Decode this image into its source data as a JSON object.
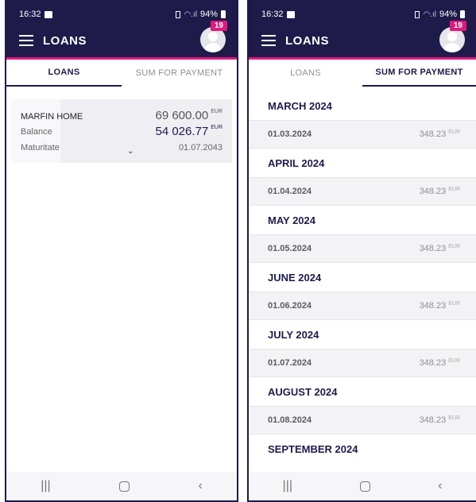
{
  "status_bar": {
    "time": "16:32",
    "battery": "94%"
  },
  "app": {
    "title": "LOANS",
    "notification_count": "19"
  },
  "tabs": [
    "LOANS",
    "SUM FOR PAYMENT"
  ],
  "loan": {
    "name": "MARFIN HOME",
    "amount": "69 600.00",
    "currency": "EUR",
    "balance_label": "Balance",
    "balance": "54 026.77",
    "maturity_label": "Maturitate",
    "maturity": "01.07.2043"
  },
  "schedule": [
    {
      "month": "MARCH 2024",
      "date": "01.03.2024",
      "amount": "348.23",
      "currency": "EUR"
    },
    {
      "month": "APRIL 2024",
      "date": "01.04.2024",
      "amount": "348.23",
      "currency": "EUR"
    },
    {
      "month": "MAY 2024",
      "date": "01.05.2024",
      "amount": "348.23",
      "currency": "EUR"
    },
    {
      "month": "JUNE 2024",
      "date": "01.06.2024",
      "amount": "348.23",
      "currency": "EUR"
    },
    {
      "month": "JULY 2024",
      "date": "01.07.2024",
      "amount": "348.23",
      "currency": "EUR"
    },
    {
      "month": "AUGUST 2024",
      "date": "01.08.2024",
      "amount": "348.23",
      "currency": "EUR"
    },
    {
      "month": "SEPTEMBER 2024"
    }
  ],
  "nav": {
    "recents_icon": "recents-icon",
    "home_icon": "home-icon",
    "back_icon": "back-icon"
  },
  "colors": {
    "header": "#1e1b4b",
    "accent": "#e0197d"
  }
}
